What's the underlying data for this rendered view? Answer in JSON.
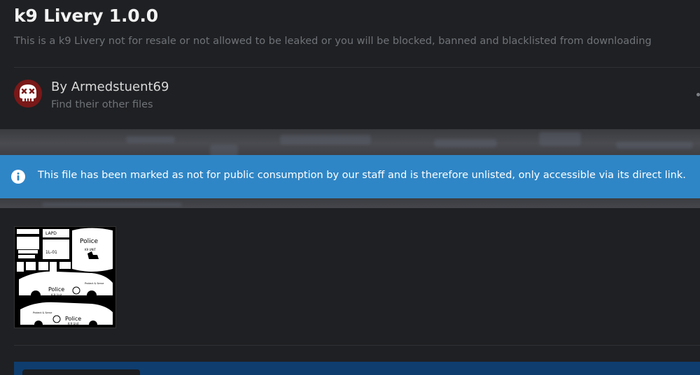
{
  "file": {
    "title": "k9 Livery 1.0.0",
    "description": "This is a k9 Livery not for resale or not allowed to be leaked or you will be blocked, banned and blacklisted from downloading"
  },
  "author": {
    "by_label": "By Armedstuent69",
    "other_files_link": "Find their other files"
  },
  "notice": {
    "icon": "info-circle-icon",
    "text": "This file has been marked as not for public consumption by our staff and is therefore unlisted, only accessible via its direct link."
  },
  "thumbnail": {
    "labels": {
      "lapd": "LAPD",
      "unit_number": "1L-01",
      "police_1": "Police",
      "police_2": "Police",
      "police_3": "Police",
      "k9_unit_1": "K-9 Unit",
      "k9_unit_2": "K-9 Unit",
      "protect_serve_1": "Protect & Serve",
      "protect_serve_2": "Protect & Serve",
      "k9_hood": "K9 UNIT"
    }
  },
  "colors": {
    "background": "#1f2023",
    "notice_bg": "#2f86c6",
    "title_text": "#f2f2f2",
    "muted_text": "#6f7378",
    "avatar_bg": "#7a1818",
    "bottom_bar": "#0f3d6e"
  }
}
